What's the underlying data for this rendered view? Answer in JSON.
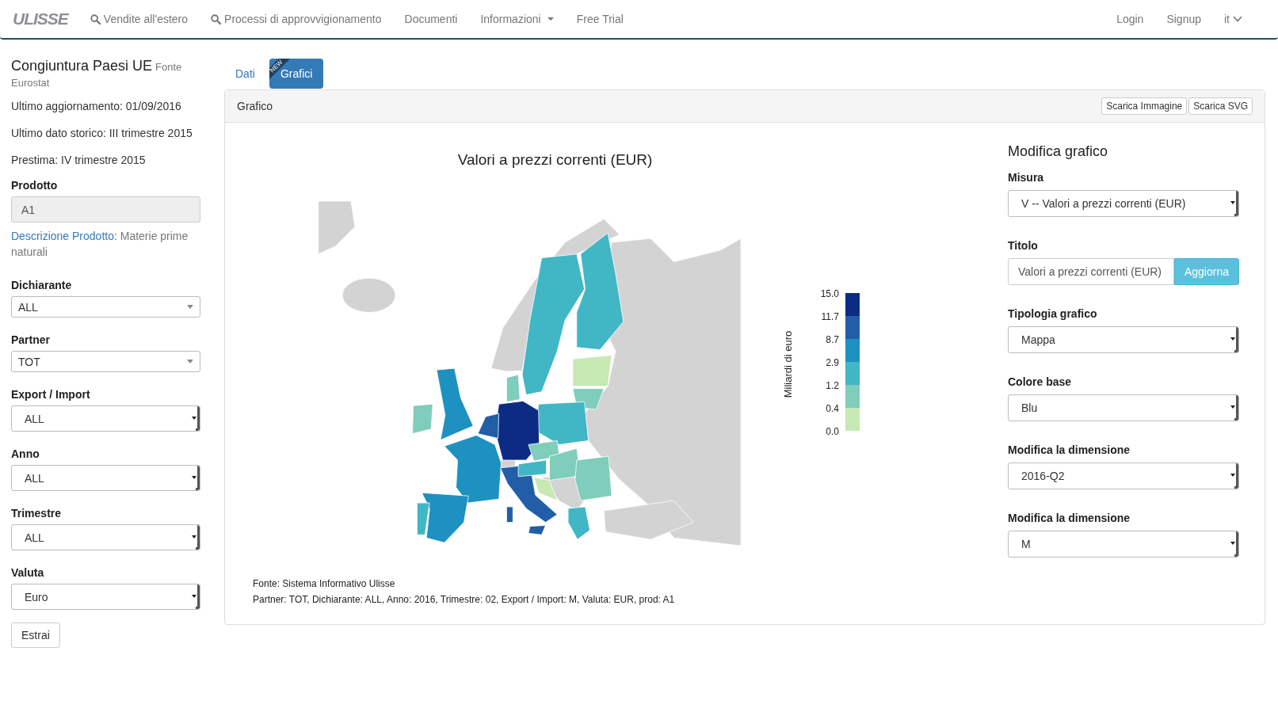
{
  "navbar": {
    "logo": "ULISSE",
    "items": [
      {
        "label": "Vendite all'estero",
        "kind": "search"
      },
      {
        "label": "Processi di approvvigionamento",
        "kind": "search"
      },
      {
        "label": "Documenti",
        "kind": "plain"
      },
      {
        "label": "Informazioni",
        "kind": "dropdown"
      },
      {
        "label": "Free Trial",
        "kind": "plain"
      }
    ],
    "right_items": [
      {
        "label": "Login",
        "kind": "plain"
      },
      {
        "label": "Signup",
        "kind": "plain"
      },
      {
        "label": "it",
        "kind": "dropdown"
      }
    ]
  },
  "sidebar": {
    "title": "Congiuntura Paesi UE",
    "source": "Fonte Eurostat",
    "info": [
      "Ultimo aggiornamento: 01/09/2016",
      "Ultimo dato storico: III trimestre 2015",
      "Prestima: IV trimestre 2015"
    ],
    "product": {
      "label": "Prodotto",
      "value": "A1",
      "disabled": true
    },
    "description": {
      "link": "Descrizione Prodotto:",
      "text": "Materie prime naturali"
    },
    "filters": [
      {
        "label": "Dichiarante",
        "value": "ALL",
        "kind": "caret"
      },
      {
        "label": "Partner",
        "value": "TOT",
        "kind": "caret"
      },
      {
        "label": "Export / Import",
        "value": "ALL",
        "kind": "native"
      },
      {
        "label": "Anno",
        "value": "ALL",
        "kind": "native"
      },
      {
        "label": "Trimestre",
        "value": "ALL",
        "kind": "native"
      },
      {
        "label": "Valuta",
        "value": "Euro",
        "kind": "native"
      }
    ],
    "submit": "Estrai"
  },
  "tabs": [
    {
      "label": "Dati",
      "selected": false
    },
    {
      "label": "Grafici",
      "selected": true,
      "ribbon": "NEW"
    }
  ],
  "panel": {
    "title": "Grafico",
    "buttons": [
      "Scarica Immagine",
      "Scarica SVG"
    ],
    "chart_title": "Valori a prezzi correnti (EUR)",
    "legend": {
      "title": "Miliardi di euro",
      "ticks": [
        "15.0",
        "11.7",
        "8.7",
        "2.9",
        "1.2",
        "0.4",
        "0.0"
      ],
      "bands": [
        {
          "color": "#0c2c84"
        },
        {
          "color": "#225ea8"
        },
        {
          "color": "#1d91c0"
        },
        {
          "color": "#41b6c4"
        },
        {
          "color": "#7fcdbb"
        },
        {
          "color": "#c7e9b4"
        }
      ]
    },
    "footer": [
      "Fonte: Sistema Informativo Ulisse",
      "Partner: TOT, Dichiarante: ALL, Anno: 2016, Trimestre: 02, Export / Import: M, Valuta: EUR, prod: A1"
    ],
    "editor": {
      "title": "Modifica grafico",
      "fields": [
        {
          "label": "Misura",
          "value": "V -- Valori a prezzi correnti (EUR)",
          "kind": "select"
        },
        {
          "label": "Titolo",
          "value": "Valori a prezzi correnti (EUR)",
          "kind": "input",
          "button": "Aggiorna"
        },
        {
          "label": "Tipologia grafico",
          "value": "Mappa",
          "kind": "select"
        },
        {
          "label": "Colore base",
          "value": "Blu",
          "kind": "select"
        },
        {
          "label": "Modifica la dimensione",
          "value": "2016-Q2",
          "kind": "select"
        },
        {
          "label": "Modifica la dimensione",
          "value": "M",
          "kind": "select"
        }
      ]
    }
  }
}
